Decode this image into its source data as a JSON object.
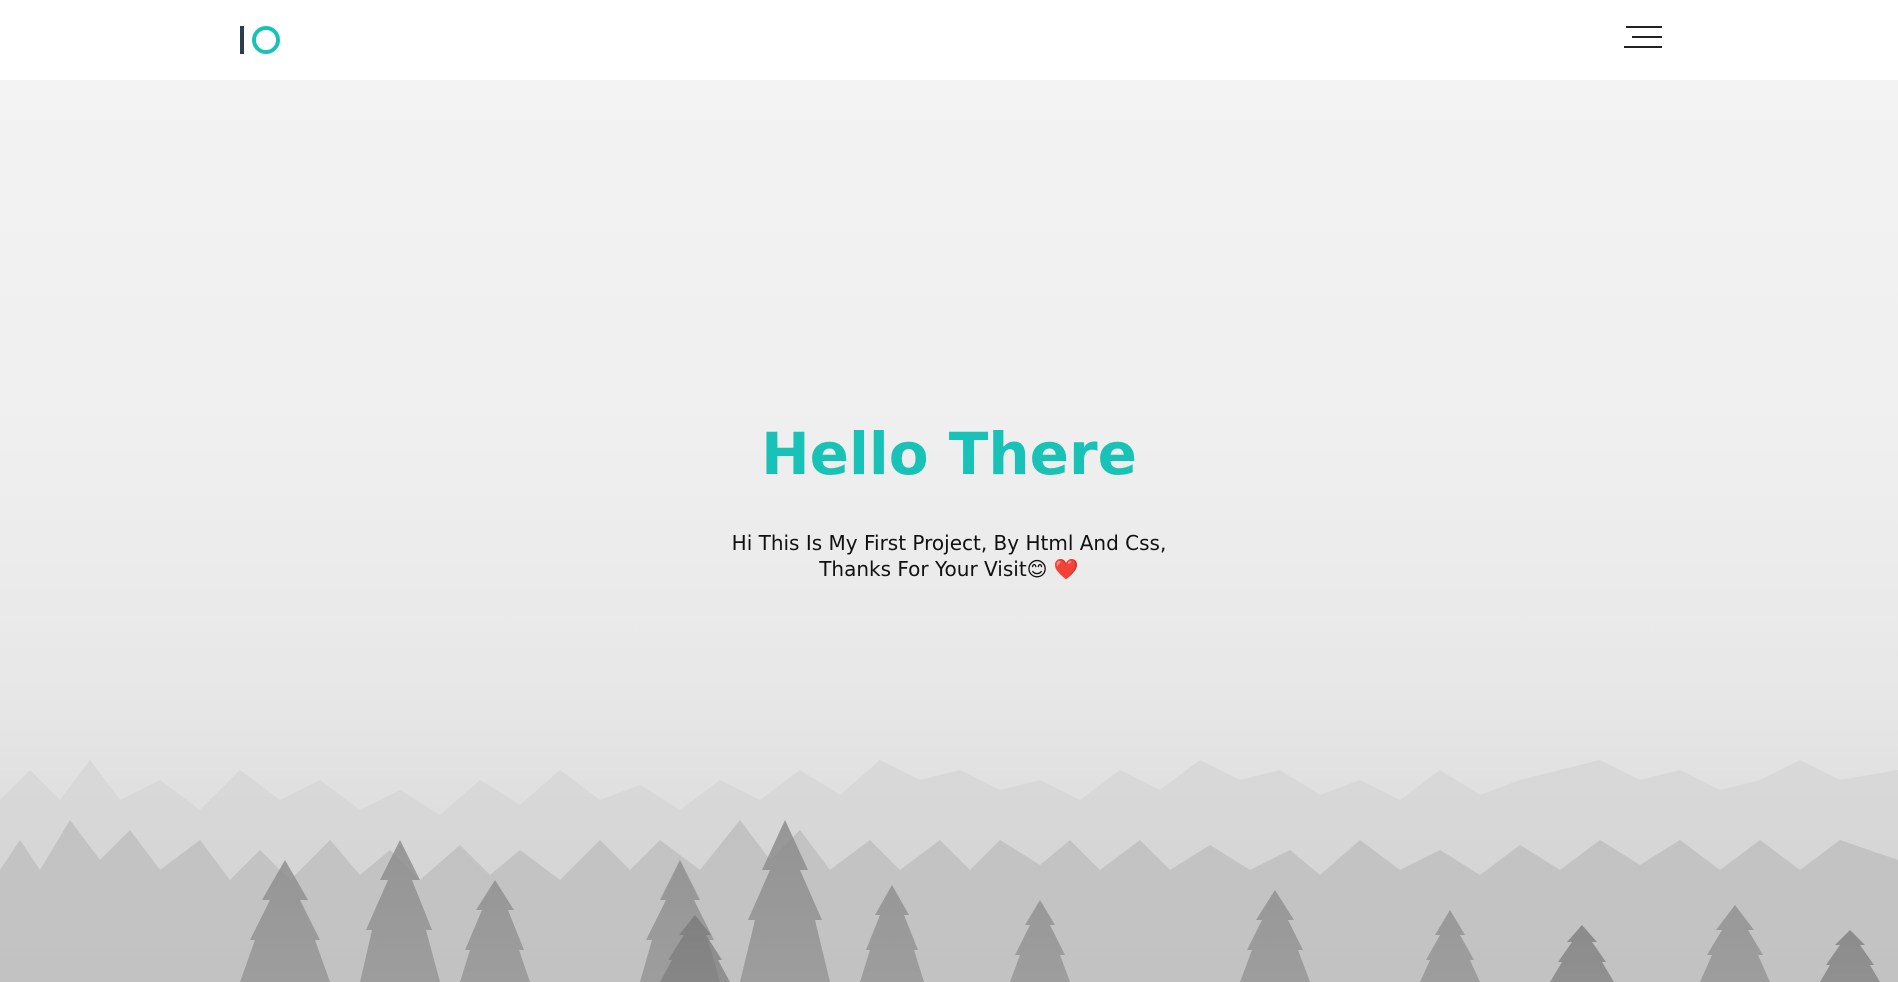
{
  "header": {
    "logo_icon": "io-logo-icon",
    "menu_icon": "hamburger-menu-icon"
  },
  "hero": {
    "title": "Hello There",
    "text": "Hi This Is My First Project, By Html And Css, Thanks For Your Visit😊 ❤️",
    "background_image": "foggy-pine-forest"
  },
  "colors": {
    "accent": "#19c2b6",
    "logo_bar": "#2b3d4f",
    "header_bg": "#ffffff",
    "text": "#111111"
  }
}
